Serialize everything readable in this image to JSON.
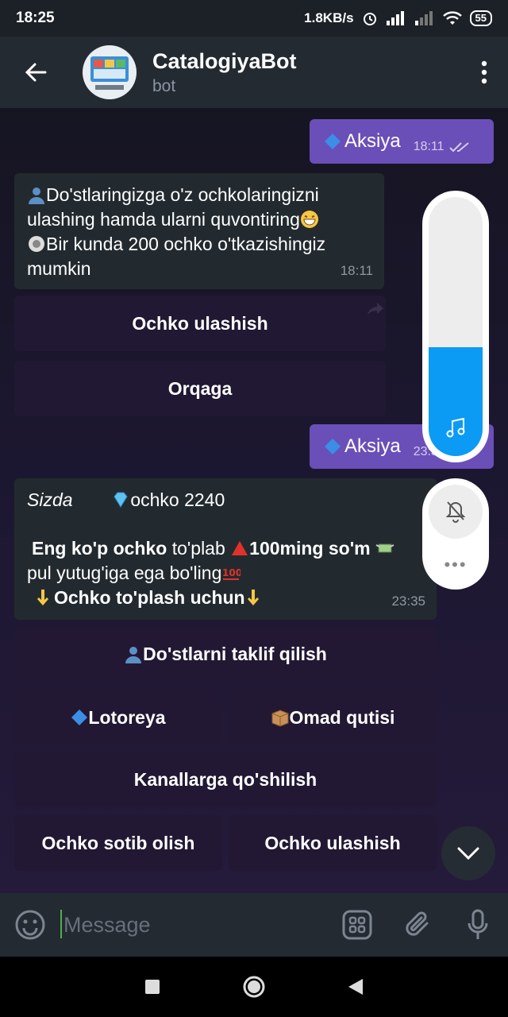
{
  "status_bar": {
    "time": "18:25",
    "net_speed": "1.8KB/s",
    "battery": "55"
  },
  "header": {
    "title": "CatalogiyaBot",
    "subtitle": "bot"
  },
  "messages": {
    "out1": {
      "text": "Aksiya",
      "time": "18:11"
    },
    "in1": {
      "line1": "Do'stlaringizga o'z ochkolaringizni",
      "line2": "ulashing hamda ularni quvontiring",
      "line3": "Bir kunda 200 ochko o'tkazishingiz",
      "line4": "mumkin",
      "time": "18:11"
    },
    "kb1": [
      "Ochko ulashish",
      "Orqaga"
    ],
    "out2": {
      "text": "Aksiya",
      "time": "23:35"
    },
    "in2": {
      "sizda": "Sizda",
      "ochko": "ochko 2240",
      "line_a_bold": "Eng ko'p ochko",
      "line_a_normal": "to'plab",
      "line_a_bold2": "100ming so'm",
      "line_b": "pul yutug'iga ega bo'ling",
      "line_c": "Ochko to'plash uchun",
      "time": "23:35"
    },
    "kb2": {
      "row1": "Do'stlarni taklif qilish",
      "row2a": "Lotoreya",
      "row2b": "Omad qutisi",
      "row3": "Kanallarga qo'shilish",
      "row4a": "Ochko sotib olish",
      "row4b": "Ochko ulashish"
    }
  },
  "volume": {
    "level": 0.42,
    "accent": "#0b9bf5"
  },
  "input": {
    "placeholder": "Message"
  },
  "colors": {
    "outgoing_bubble": "#6a4fb8",
    "incoming_bubble": "#232a2f",
    "header_bg": "#242a32"
  }
}
